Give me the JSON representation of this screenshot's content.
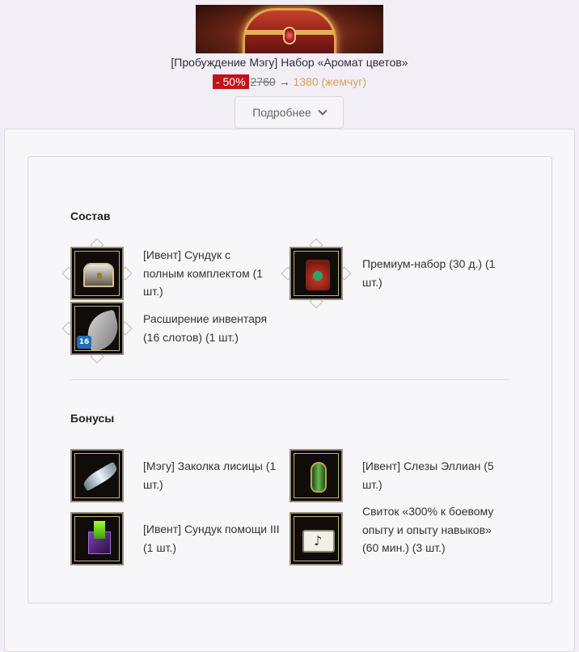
{
  "header": {
    "title": "[Пробуждение Мэгу] Набор «Аромат цветов»",
    "discount": "- 50%",
    "old_price": "2760",
    "arrow": "→",
    "new_price": "1380 (жемчуг)",
    "details_button": "Подробнее"
  },
  "composition": {
    "title": "Состав",
    "items": [
      {
        "label": "[Ивент] Сундук с полным комплектом (1 шт.)",
        "icon": "chest-icon"
      },
      {
        "label": "Премиум-набор (30 д.) (1 шт.)",
        "icon": "premium-set-icon"
      },
      {
        "label": "Расширение инвентаря (16 слотов) (1 шт.)",
        "icon": "inventory-bag-icon",
        "badge": "16"
      }
    ]
  },
  "bonuses": {
    "title": "Бонусы",
    "items": [
      {
        "label": "[Мэгу] Заколка лисицы (1 шт.)",
        "icon": "hairpin-icon"
      },
      {
        "label": "[Ивент] Слезы Эллиан (5 шт.)",
        "icon": "vase-icon"
      },
      {
        "label": "[Ивент] Сундук помощи III (1 шт.)",
        "icon": "cube-icon"
      },
      {
        "label": "Свиток «300% к боевому опыту и опыту навыков» (60 мин.) (3 шт.)",
        "icon": "scroll-icon"
      }
    ]
  }
}
